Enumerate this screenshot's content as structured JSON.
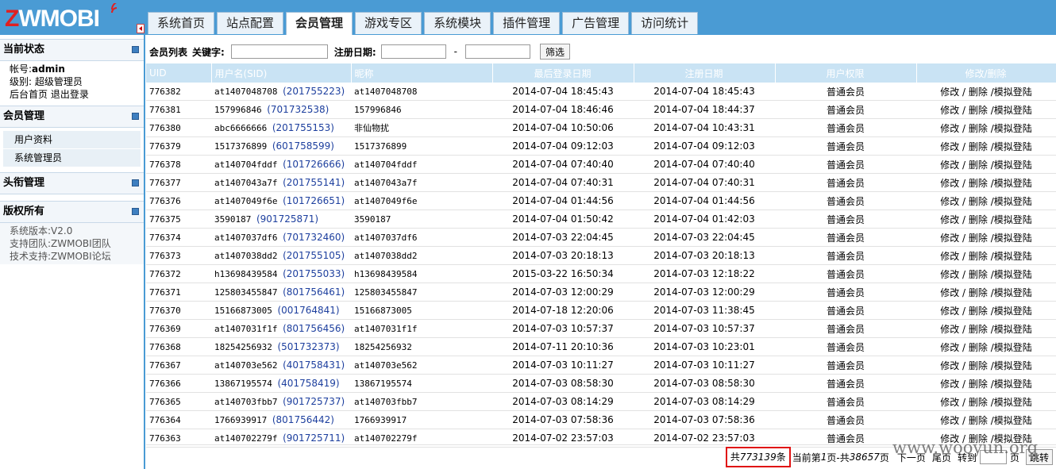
{
  "header": {
    "logo_text_1": "Z",
    "logo_text_2": "WMOBI",
    "tabs": [
      {
        "label": "系统首页",
        "active": false
      },
      {
        "label": "站点配置",
        "active": false
      },
      {
        "label": "会员管理",
        "active": true
      },
      {
        "label": "游戏专区",
        "active": false
      },
      {
        "label": "系统模块",
        "active": false
      },
      {
        "label": "插件管理",
        "active": false
      },
      {
        "label": "广告管理",
        "active": false
      },
      {
        "label": "访问统计",
        "active": false
      }
    ]
  },
  "sidebar": {
    "status_title": "当前状态",
    "account_label": "帐号:",
    "account_value": "admin",
    "level_label": "级别:",
    "level_value": "超级管理员",
    "home_link": "后台首页",
    "logout_link": "退出登录",
    "member_title": "会员管理",
    "member_items": [
      "用户资料",
      "系统管理员"
    ],
    "head_title": "头衔管理",
    "copyright_title": "版权所有",
    "version": "系统版本:V2.0",
    "team": "支持团队:ZWMOBI团队",
    "support": "技术支持:ZWMOBI论坛"
  },
  "search": {
    "list_title": "会员列表",
    "keyword_label": "关键字:",
    "reg_date_label": "注册日期:",
    "dash": "-",
    "filter_button": "筛选"
  },
  "table": {
    "headers": [
      "UID",
      "用户名(SID)",
      "昵称",
      "最后登录日期",
      "注册日期",
      "用户权限",
      "修改/删除"
    ],
    "action_edit": "修改",
    "action_delete": "删除",
    "action_login": "模拟登陆",
    "rows": [
      {
        "uid": "776382",
        "user": "at1407048708",
        "sid": "(201755223)",
        "nick": "at1407048708",
        "last": "2014-07-04 18:45:43",
        "reg": "2014-07-04 18:45:43",
        "role": "普通会员"
      },
      {
        "uid": "776381",
        "user": "157996846",
        "sid": "(701732538)",
        "nick": "157996846",
        "last": "2014-07-04 18:46:46",
        "reg": "2014-07-04 18:44:37",
        "role": "普通会员"
      },
      {
        "uid": "776380",
        "user": "abc6666666",
        "sid": "(201755153)",
        "nick": "非仙物扰",
        "last": "2014-07-04 10:50:06",
        "reg": "2014-07-04 10:43:31",
        "role": "普通会员"
      },
      {
        "uid": "776379",
        "user": "1517376899",
        "sid": "(601758599)",
        "nick": "1517376899",
        "last": "2014-07-04 09:12:03",
        "reg": "2014-07-04 09:12:03",
        "role": "普通会员"
      },
      {
        "uid": "776378",
        "user": "at140704fddf",
        "sid": "(101726666)",
        "nick": "at140704fddf",
        "last": "2014-07-04 07:40:40",
        "reg": "2014-07-04 07:40:40",
        "role": "普通会员"
      },
      {
        "uid": "776377",
        "user": "at1407043a7f",
        "sid": "(201755141)",
        "nick": "at1407043a7f",
        "last": "2014-07-04 07:40:31",
        "reg": "2014-07-04 07:40:31",
        "role": "普通会员"
      },
      {
        "uid": "776376",
        "user": "at1407049f6e",
        "sid": "(101726651)",
        "nick": "at1407049f6e",
        "last": "2014-07-04 01:44:56",
        "reg": "2014-07-04 01:44:56",
        "role": "普通会员"
      },
      {
        "uid": "776375",
        "user": "3590187",
        "sid": "(901725871)",
        "nick": "3590187",
        "last": "2014-07-04 01:50:42",
        "reg": "2014-07-04 01:42:03",
        "role": "普通会员"
      },
      {
        "uid": "776374",
        "user": "at1407037df6",
        "sid": "(701732460)",
        "nick": "at1407037df6",
        "last": "2014-07-03 22:04:45",
        "reg": "2014-07-03 22:04:45",
        "role": "普通会员"
      },
      {
        "uid": "776373",
        "user": "at1407038dd2",
        "sid": "(201755105)",
        "nick": "at1407038dd2",
        "last": "2014-07-03 20:18:13",
        "reg": "2014-07-03 20:18:13",
        "role": "普通会员"
      },
      {
        "uid": "776372",
        "user": "h13698439584",
        "sid": "(201755033)",
        "nick": "h13698439584",
        "last": "2015-03-22 16:50:34",
        "reg": "2014-07-03 12:18:22",
        "role": "普通会员"
      },
      {
        "uid": "776371",
        "user": "125803455847",
        "sid": "(801756461)",
        "nick": "125803455847",
        "last": "2014-07-03 12:00:29",
        "reg": "2014-07-03 12:00:29",
        "role": "普通会员"
      },
      {
        "uid": "776370",
        "user": "15166873005",
        "sid": "(001764841)",
        "nick": "15166873005",
        "last": "2014-07-18 12:20:06",
        "reg": "2014-07-03 11:38:45",
        "role": "普通会员"
      },
      {
        "uid": "776369",
        "user": "at1407031f1f",
        "sid": "(801756456)",
        "nick": "at1407031f1f",
        "last": "2014-07-03 10:57:37",
        "reg": "2014-07-03 10:57:37",
        "role": "普通会员"
      },
      {
        "uid": "776368",
        "user": "18254256932",
        "sid": "(501732373)",
        "nick": "18254256932",
        "last": "2014-07-11 20:10:36",
        "reg": "2014-07-03 10:23:01",
        "role": "普通会员"
      },
      {
        "uid": "776367",
        "user": "at140703e562",
        "sid": "(401758431)",
        "nick": "at140703e562",
        "last": "2014-07-03 10:11:27",
        "reg": "2014-07-03 10:11:27",
        "role": "普通会员"
      },
      {
        "uid": "776366",
        "user": "13867195574",
        "sid": "(401758419)",
        "nick": "13867195574",
        "last": "2014-07-03 08:58:30",
        "reg": "2014-07-03 08:58:30",
        "role": "普通会员"
      },
      {
        "uid": "776365",
        "user": "at140703fbb7",
        "sid": "(901725737)",
        "nick": "at140703fbb7",
        "last": "2014-07-03 08:14:29",
        "reg": "2014-07-03 08:14:29",
        "role": "普通会员"
      },
      {
        "uid": "776364",
        "user": "1766939917",
        "sid": "(801756442)",
        "nick": "1766939917",
        "last": "2014-07-03 07:58:36",
        "reg": "2014-07-03 07:58:36",
        "role": "普通会员"
      },
      {
        "uid": "776363",
        "user": "at140702279f",
        "sid": "(901725711)",
        "nick": "at140702279f",
        "last": "2014-07-02 23:57:03",
        "reg": "2014-07-02 23:57:03",
        "role": "普通会员"
      }
    ]
  },
  "pager": {
    "total_prefix": "共",
    "total_count": "773139",
    "total_suffix": "条",
    "current_prefix": "当前第",
    "current_page": "1",
    "current_suffix": "页-共",
    "total_pages": "38657",
    "pages_suffix": "页",
    "next": "下一页",
    "last": "尾页",
    "goto": "转到",
    "page_unit": "页",
    "jump_button": "跳转"
  },
  "watermark": "www.wooyun.org",
  "colors": {
    "accent": "#4a9bd4",
    "header_row": "#c9e3f4",
    "highlight_border": "#e01010",
    "sid_blue": "#1d3f9e"
  }
}
